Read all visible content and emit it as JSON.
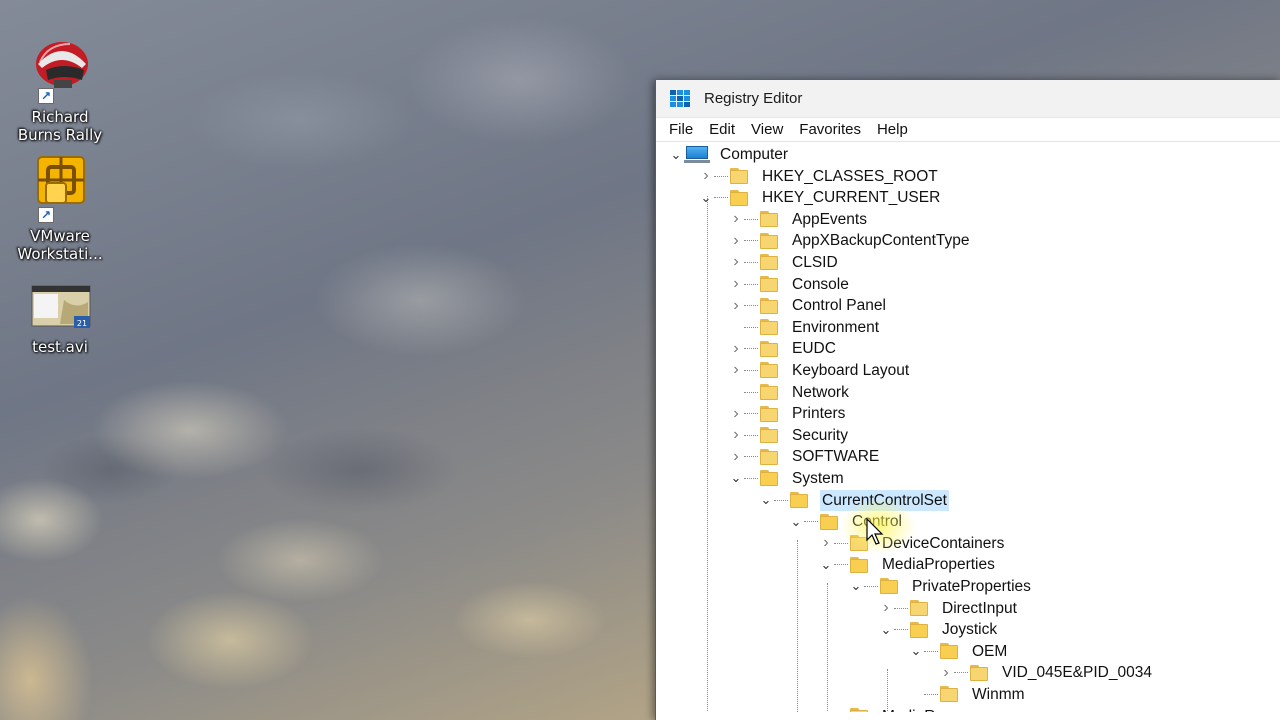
{
  "desktop": {
    "icons": [
      {
        "label": "Richard Burns Rally",
        "icon": "helmet-icon"
      },
      {
        "label": "VMware Workstati...",
        "icon": "vmware-icon"
      },
      {
        "label": "test.avi",
        "icon": "video-file-icon"
      }
    ]
  },
  "window": {
    "title": "Registry Editor",
    "menu": [
      "File",
      "Edit",
      "View",
      "Favorites",
      "Help"
    ]
  },
  "tree": {
    "root": "Computer",
    "nodes": [
      {
        "label": "HKEY_CLASSES_ROOT",
        "depth": 1,
        "expander": "collapsed"
      },
      {
        "label": "HKEY_CURRENT_USER",
        "depth": 1,
        "expander": "expanded"
      },
      {
        "label": "AppEvents",
        "depth": 2,
        "expander": "collapsed"
      },
      {
        "label": "AppXBackupContentType",
        "depth": 2,
        "expander": "collapsed"
      },
      {
        "label": "CLSID",
        "depth": 2,
        "expander": "collapsed"
      },
      {
        "label": "Console",
        "depth": 2,
        "expander": "collapsed"
      },
      {
        "label": "Control Panel",
        "depth": 2,
        "expander": "collapsed"
      },
      {
        "label": "Environment",
        "depth": 2,
        "expander": "none"
      },
      {
        "label": "EUDC",
        "depth": 2,
        "expander": "collapsed"
      },
      {
        "label": "Keyboard Layout",
        "depth": 2,
        "expander": "collapsed"
      },
      {
        "label": "Network",
        "depth": 2,
        "expander": "none"
      },
      {
        "label": "Printers",
        "depth": 2,
        "expander": "collapsed"
      },
      {
        "label": "Security",
        "depth": 2,
        "expander": "collapsed"
      },
      {
        "label": "SOFTWARE",
        "depth": 2,
        "expander": "collapsed"
      },
      {
        "label": "System",
        "depth": 2,
        "expander": "expanded"
      },
      {
        "label": "CurrentControlSet",
        "depth": 3,
        "expander": "expanded",
        "selected": true
      },
      {
        "label": "Control",
        "depth": 4,
        "expander": "expanded"
      },
      {
        "label": "DeviceContainers",
        "depth": 5,
        "expander": "collapsed"
      },
      {
        "label": "MediaProperties",
        "depth": 5,
        "expander": "expanded"
      },
      {
        "label": "PrivateProperties",
        "depth": 6,
        "expander": "expanded"
      },
      {
        "label": "DirectInput",
        "depth": 7,
        "expander": "collapsed"
      },
      {
        "label": "Joystick",
        "depth": 7,
        "expander": "expanded"
      },
      {
        "label": "OEM",
        "depth": 8,
        "expander": "expanded"
      },
      {
        "label": "VID_045E&PID_0034",
        "depth": 9,
        "expander": "collapsed"
      },
      {
        "label": "Winmm",
        "depth": 8,
        "expander": "none"
      },
      {
        "label": "MediaResources",
        "depth": 5,
        "expander": "collapsed"
      }
    ]
  },
  "colors": {
    "selection": "#cce8ff",
    "folder": "#f7d672",
    "highlight": "#fff550"
  }
}
